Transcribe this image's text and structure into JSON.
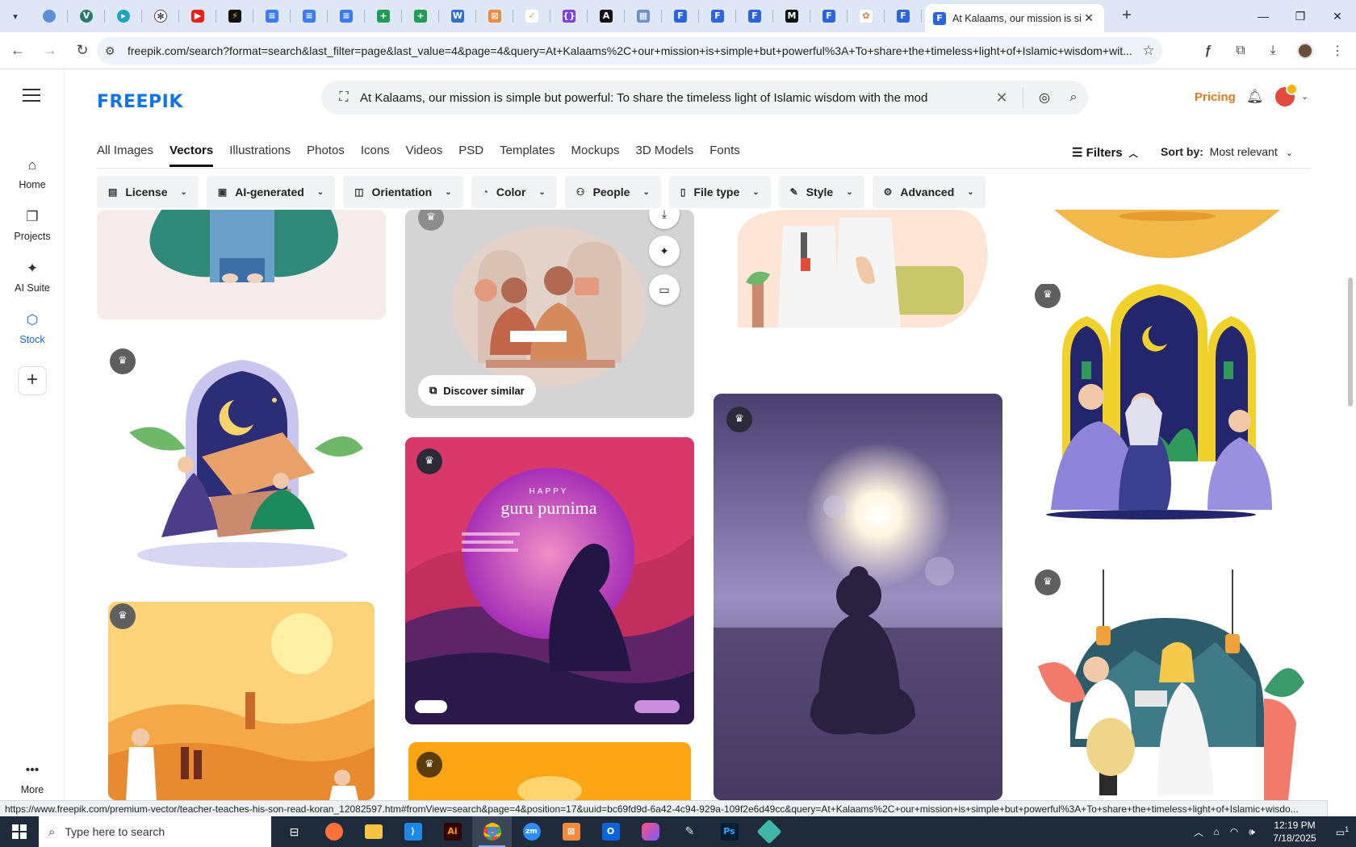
{
  "browser": {
    "active_tab_title": "At Kalaams, our mission is simp",
    "url": "freepik.com/search?format=search&last_filter=page&last_value=4&page=4&query=At+Kalaams%2C+our+mission+is+simple+but+powerful%3A+To+share+the+timeless+light+of+Islamic+wisdom+wit...",
    "status_url": "https://www.freepik.com/premium-vector/teacher-teaches-his-son-read-koran_12082597.htm#fromView=search&page=4&position=17&uuid=bc69fd9d-6a42-4c94-929a-109f2e6d49cc&query=At+Kalaams%2C+our+mission+is+simple+but+powerful%3A+To+share+the+timeless+light+of+Islamic+wisdo..."
  },
  "header": {
    "logo": "FREEPIK",
    "search_query": "At Kalaams, our mission is simple but powerful: To share the timeless light of Islamic wisdom with the mod",
    "pricing": "Pricing"
  },
  "sidebar": {
    "items": [
      {
        "label": "Home"
      },
      {
        "label": "Projects"
      },
      {
        "label": "AI Suite"
      },
      {
        "label": "Stock"
      },
      {
        "label": "More"
      }
    ]
  },
  "content_tabs": [
    "All Images",
    "Vectors",
    "Illustrations",
    "Photos",
    "Icons",
    "Videos",
    "PSD",
    "Templates",
    "Mockups",
    "3D Models",
    "Fonts"
  ],
  "toolbar": {
    "filters_label": "Filters",
    "sort_label": "Sort by:",
    "sort_value": "Most relevant"
  },
  "filters": [
    "License",
    "AI-generated",
    "Orientation",
    "Color",
    "People",
    "File type",
    "Style",
    "Advanced"
  ],
  "cards": {
    "discover_similar": "Discover similar",
    "poster_happy": "HAPPY",
    "poster_title": "guru purnima"
  },
  "taskbar": {
    "search_placeholder": "Type here to search",
    "time": "12:19 PM",
    "date": "7/18/2025",
    "notification_count": "1"
  },
  "colors": {
    "brand": "#1273eb",
    "pricing": "#e8781a",
    "active_nav": "#1f63e5"
  }
}
